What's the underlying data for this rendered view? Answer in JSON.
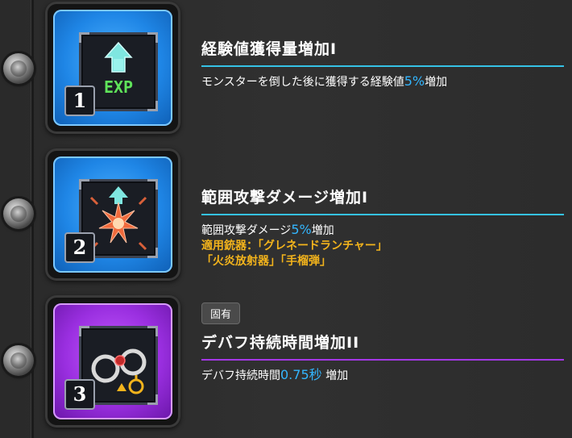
{
  "skills": [
    {
      "number": "1",
      "icon": "exp-up-icon",
      "tile_color": "#1f86e6",
      "title": "経験値獲得量増加I",
      "desc_prefix": "モンスターを倒した後に獲得する経験値",
      "desc_value": "5%",
      "desc_suffix": "増加",
      "icon_text": "EXP"
    },
    {
      "number": "2",
      "icon": "explosion-up-icon",
      "tile_color": "#1f86e6",
      "title": "範囲攻撃ダメージ増加I",
      "desc_prefix": "範囲攻撃ダメージ",
      "desc_value": "5%",
      "desc_suffix": "増加",
      "weapons_line1": "適用銃器：「グレネードランチャー」",
      "weapons_line2": "「火炎放射器」「手榴弾」"
    },
    {
      "number": "3",
      "icon": "handcuffs-icon",
      "tile_color": "#9a2fe0",
      "tag": "固有",
      "title": "デバフ持続時間増加II",
      "desc_prefix": "デバフ持続時間",
      "desc_value": "0.75秒",
      "desc_suffix": " 増加"
    }
  ],
  "colors": {
    "accent_cyan": "#35c2e6",
    "accent_purple": "#a437e6",
    "highlight_blue": "#33b6ff",
    "weapon_gold": "#f2b31c"
  }
}
